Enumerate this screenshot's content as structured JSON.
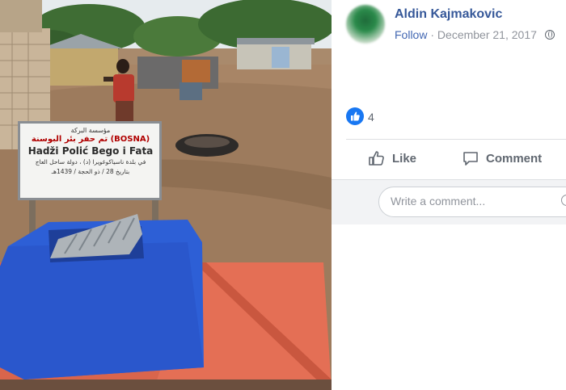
{
  "post": {
    "author": "Aldin Kajmakovic",
    "follow_label": "Follow",
    "separator": "·",
    "date": "December 21, 2017",
    "privacy_icon": "globe-icon"
  },
  "photo": {
    "sign": {
      "arabic_line1": "مؤسسة البركة",
      "arabic_line2": "تم حفر بئر البوسنة (BOSNA)",
      "name_line": "Hadži Polić Bego i Fata",
      "arabic_line3": "في بلدة ناسياكوغويرا (د) ، دولة ساحل العاج",
      "arabic_line4": "بتاريخ 28 / ذو الحجة / 1439هـ"
    }
  },
  "reactions": {
    "icon": "thumbs-up-icon",
    "count": "4"
  },
  "actions": {
    "like_label": "Like",
    "comment_label": "Comment"
  },
  "comment_box": {
    "placeholder": "Write a comment..."
  },
  "colors": {
    "link": "#365899",
    "follow": "#4267b2",
    "like_badge": "#1877f2",
    "meta_grey": "#90949c"
  }
}
